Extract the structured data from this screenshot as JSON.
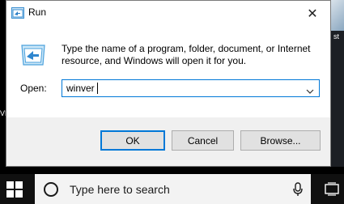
{
  "dialog": {
    "title": "Run",
    "close_glyph": "✕",
    "description": "Type the name of a program, folder, document, or Internet resource, and Windows will open it for you.",
    "open_label": "Open:",
    "open_value": "winver",
    "buttons": {
      "ok": "OK",
      "cancel": "Cancel",
      "browse": "Browse..."
    },
    "accent_color": "#0078d7"
  },
  "desktop": {
    "left_text": "VE",
    "right_text": "st"
  },
  "taskbar": {
    "search_placeholder": "Type here to search",
    "icons": [
      "windows-start-icon",
      "cortana-circle-icon",
      "microphone-icon",
      "task-view-icon"
    ]
  }
}
